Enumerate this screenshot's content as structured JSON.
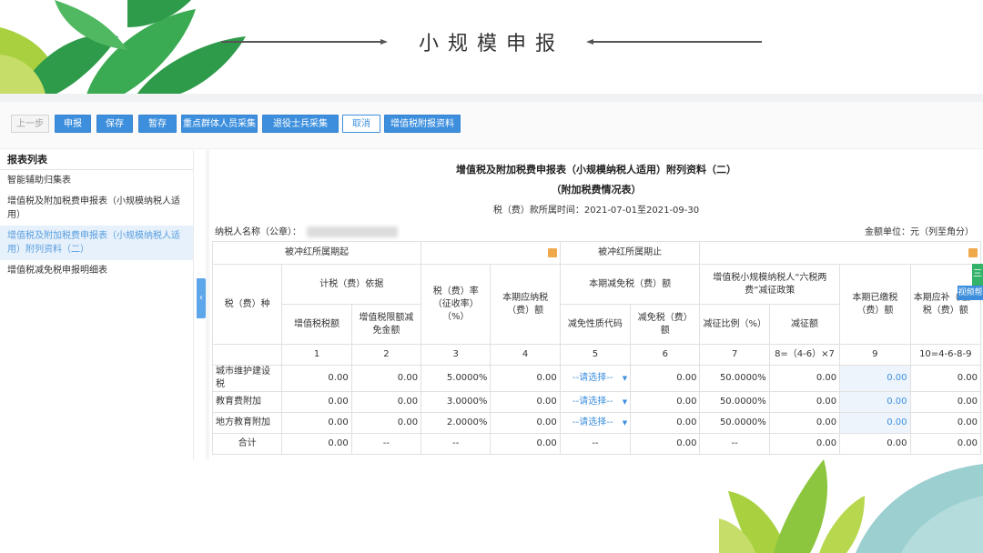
{
  "slide": {
    "title": "小规模申报"
  },
  "toolbar": {
    "buttons": [
      {
        "label": "上一步",
        "style": "ghost"
      },
      {
        "label": "申报",
        "style": "primary"
      },
      {
        "label": "保存",
        "style": "primary"
      },
      {
        "label": "暂存",
        "style": "primary"
      },
      {
        "label": "重点群体人员采集",
        "style": "primary"
      },
      {
        "label": "退役士兵采集",
        "style": "primary"
      },
      {
        "label": "取消",
        "style": "outline"
      },
      {
        "label": "增值税附报资料",
        "style": "primary"
      }
    ]
  },
  "sidebar": {
    "title": "报表列表",
    "items": [
      {
        "label": "智能辅助归集表",
        "active": false
      },
      {
        "label": "增值税及附加税费申报表（小规模纳税人适用）",
        "active": false
      },
      {
        "label": "增值税及附加税费申报表（小规模纳税人适用）附列资料（二）",
        "active": true
      },
      {
        "label": "增值税减免税申报明细表",
        "active": false
      }
    ],
    "toggle_icon": "‹"
  },
  "form": {
    "title": "增值税及附加税费申报表（小规模纳税人适用）附列资料（二）",
    "subtitle": "（附加税费情况表）",
    "period": "税（费）款所属时间：2021-07-01至2021-09-30",
    "taxpayer_label": "纳税人名称（公章）：",
    "unit": "金额单位：元（列至角分）",
    "period_start_label": "被冲红所属期起",
    "period_end_label": "被冲红所属期止",
    "headers": {
      "tax_type": "税（费）种",
      "basis_group": "计税（费）依据",
      "vat_amount": "增值税税额",
      "vat_credit_reduction": "增值税限额减免金额",
      "rate": "税（费）率（征收率）（%）",
      "payable": "本期应纳税（费）额",
      "relief_group": "本期减免税（费）额",
      "relief_code": "减免性质代码",
      "relief_amount": "减免税（费）额",
      "six_tax_group": "增值税小规模纳税人“六税两费”减征政策",
      "reduction_ratio": "减征比例（%）",
      "reduction_amount": "减征额",
      "paid": "本期已缴税（费）额",
      "refund": "本期应补（退）税（费）额"
    },
    "col_numbers": [
      "1",
      "2",
      "3",
      "4",
      "5",
      "6",
      "7",
      "8=（4-6）×7",
      "9",
      "10=4-6-8-9"
    ],
    "rows": [
      {
        "name": "城市维护建设税",
        "c1": "0.00",
        "c2": "0.00",
        "c3": "5.0000%",
        "c4": "0.00",
        "c5": "--请选择--",
        "c6": "0.00",
        "c7": "50.0000%",
        "c8": "0.00",
        "c9": "0.00",
        "c10": "0.00"
      },
      {
        "name": "教育费附加",
        "c1": "0.00",
        "c2": "0.00",
        "c3": "3.0000%",
        "c4": "0.00",
        "c5": "--请选择--",
        "c6": "0.00",
        "c7": "50.0000%",
        "c8": "0.00",
        "c9": "0.00",
        "c10": "0.00"
      },
      {
        "name": "地方教育附加",
        "c1": "0.00",
        "c2": "0.00",
        "c3": "2.0000%",
        "c4": "0.00",
        "c5": "--请选择--",
        "c6": "0.00",
        "c7": "50.0000%",
        "c8": "0.00",
        "c9": "0.00",
        "c10": "0.00"
      }
    ],
    "total": {
      "name": "合计",
      "c1": "0.00",
      "c2": "--",
      "c3": "--",
      "c4": "0.00",
      "c5": "--",
      "c6": "0.00",
      "c7": "--",
      "c8": "0.00",
      "c9": "0.00",
      "c10": "0.00"
    }
  },
  "edge": {
    "green_tab": "三",
    "video_tab": "视频帮"
  },
  "colors": {
    "primary": "#3d8fdd",
    "active_bg": "#e6f1fc",
    "leaf_dark": "#2e9b4a",
    "leaf_light": "#a9d13f",
    "leaf_teal": "#9ccfd0"
  }
}
